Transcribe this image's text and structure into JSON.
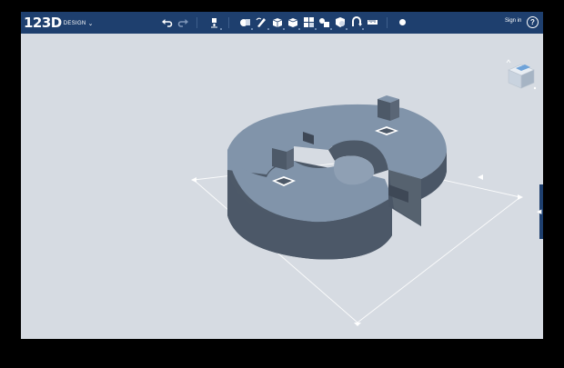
{
  "app": {
    "logo": "123D",
    "logo_sub": "DESIGN",
    "menu_chevron": "⌄"
  },
  "toolbar": {
    "buttons": [
      {
        "name": "undo-icon"
      },
      {
        "name": "redo-icon"
      },
      {
        "name": "transform-icon"
      },
      {
        "name": "primitives-icon"
      },
      {
        "name": "sketch-icon"
      },
      {
        "name": "construct-icon"
      },
      {
        "name": "modify-icon"
      },
      {
        "name": "pattern-icon"
      },
      {
        "name": "grouping-icon"
      },
      {
        "name": "combine-icon"
      },
      {
        "name": "snap-icon"
      },
      {
        "name": "measure-icon"
      },
      {
        "name": "material-icon"
      }
    ],
    "sign_in": "Sign in",
    "help": "?"
  },
  "colors": {
    "toolbar_bg": "#1e3f6e",
    "viewport_bg": "#d6dbe2",
    "model_top": "#8194aa",
    "model_side": "#4d5968",
    "grid_line": "#ffffff"
  },
  "scene": {
    "object": "split-ring-with-square-pegs",
    "view": "perspective",
    "grid": true
  }
}
